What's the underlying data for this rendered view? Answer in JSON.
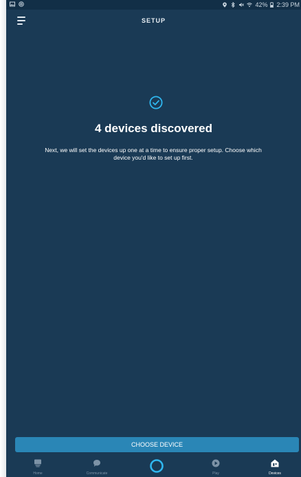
{
  "status_bar": {
    "time": "2:39 PM",
    "battery": "42%"
  },
  "header": {
    "title": "SETUP"
  },
  "main": {
    "headline": "4 devices discovered",
    "description": "Next, we will set the devices up one at a time to ensure proper setup. Choose which device you'd like to set up first."
  },
  "action": {
    "choose_label": "CHOOSE DEVICE"
  },
  "bottom_nav": {
    "home": "Home",
    "communicate": "Communicate",
    "play": "Play",
    "devices": "Devices"
  },
  "colors": {
    "background": "#1a3a55",
    "accent": "#2a86b6",
    "alexa_cyan": "#2fb7f0"
  }
}
